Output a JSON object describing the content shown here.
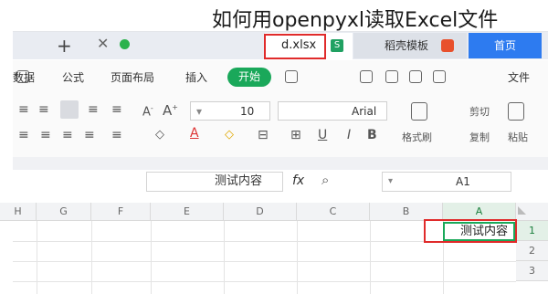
{
  "caption": "如何用openpyxl读取Excel文件",
  "tabs": {
    "new_tab_icon": "plus-icon",
    "close_icon": "close-icon",
    "docer": "首页",
    "template": "稻壳模板",
    "file": "d.xlsx",
    "file_badge": "S"
  },
  "menu": {
    "items": [
      "文件",
      "开始",
      "插入",
      "页面布局",
      "公式",
      "数据"
    ],
    "active": "开始"
  },
  "toolbar": {
    "paste": "粘贴",
    "cut": "剪切",
    "copy": "复制",
    "format_painter": "格式刷",
    "font_name": "Arial",
    "font_size": "10",
    "bold": "B",
    "italic": "I",
    "underline": "U"
  },
  "formula_bar": {
    "cell_ref": "A1",
    "fx": "fx",
    "content": "测试内容"
  },
  "sheet": {
    "columns": [
      "A",
      "B",
      "C",
      "D",
      "E",
      "F",
      "G",
      "H"
    ],
    "rows": [
      "1",
      "2",
      "3"
    ],
    "cell_a1": "测试内容"
  },
  "colors": {
    "accent_green": "#1aa85a",
    "highlight_red": "#e02b2b",
    "docer_blue": "#2d7bf0"
  }
}
